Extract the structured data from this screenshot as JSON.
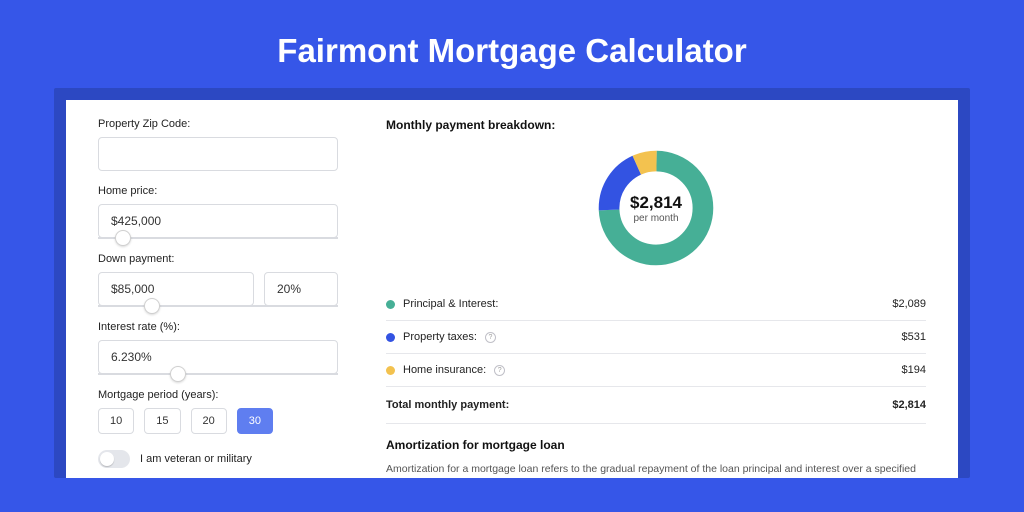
{
  "header": {
    "title": "Fairmont Mortgage Calculator"
  },
  "form": {
    "zip": {
      "label": "Property Zip Code:",
      "value": ""
    },
    "home_price": {
      "label": "Home price:",
      "value": "$425,000",
      "slider_pct": 7
    },
    "down_payment": {
      "label": "Down payment:",
      "value": "$85,000",
      "pct_value": "20%",
      "slider_pct": 19
    },
    "interest": {
      "label": "Interest rate (%):",
      "value": "6.230%",
      "slider_pct": 30
    },
    "period": {
      "label": "Mortgage period (years):",
      "options": [
        "10",
        "15",
        "20",
        "30"
      ],
      "active": "30"
    },
    "veteran": {
      "label": "I am veteran or military",
      "on": false
    }
  },
  "breakdown": {
    "title": "Monthly payment breakdown:",
    "donut": {
      "amount": "$2,814",
      "sub": "per month"
    },
    "items": [
      {
        "color": "green",
        "label": "Principal & Interest:",
        "amount": "$2,089"
      },
      {
        "color": "blue",
        "label": "Property taxes:",
        "info": true,
        "amount": "$531"
      },
      {
        "color": "yellow",
        "label": "Home insurance:",
        "info": true,
        "amount": "$194"
      }
    ],
    "total": {
      "label": "Total monthly payment:",
      "amount": "$2,814"
    }
  },
  "amortization": {
    "title": "Amortization for mortgage loan",
    "text": "Amortization for a mortgage loan refers to the gradual repayment of the loan principal and interest over a specified"
  },
  "chart_data": {
    "type": "pie",
    "title": "Monthly payment breakdown",
    "series": [
      {
        "name": "Principal & Interest",
        "value": 2089,
        "color": "#46af96"
      },
      {
        "name": "Property taxes",
        "value": 531,
        "color": "#3353e2"
      },
      {
        "name": "Home insurance",
        "value": 194,
        "color": "#f3c24f"
      }
    ],
    "total": 2814,
    "center_label": "$2,814 per month"
  }
}
